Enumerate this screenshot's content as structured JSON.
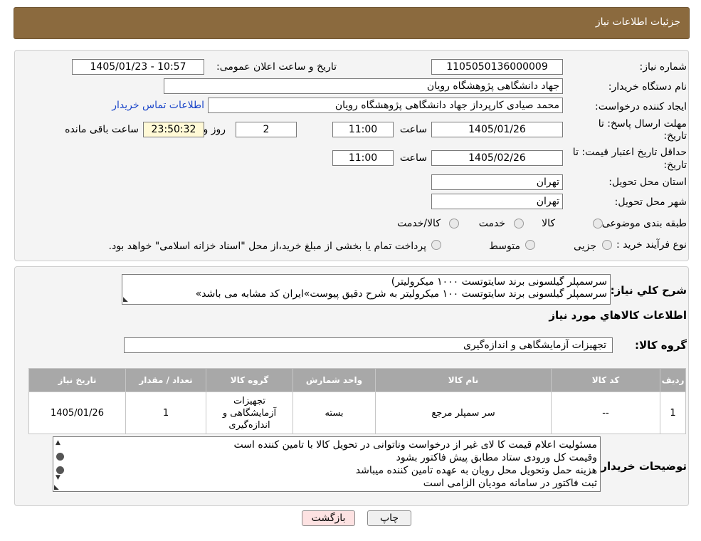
{
  "header": {
    "title": "جزئیات اطلاعات نیاز"
  },
  "form": {
    "need_number_label": "شماره نیاز:",
    "need_number": "1105050136000009",
    "announce_label": "تاریخ و ساعت اعلان عمومی:",
    "announce_value": "1405/01/23 - 10:57",
    "buyer_org_label": "نام دستگاه خریدار:",
    "buyer_org": "جهاد دانشگاهی پژوهشگاه رویان",
    "creator_label": "ایجاد کننده درخواست:",
    "creator": "محمد صیادی کارپرداز جهاد دانشگاهی پژوهشگاه رویان",
    "contact_link": "اطلاعات تماس خریدار",
    "deadline_label_1": "مهلت ارسال پاسخ: تا",
    "deadline_label_2": "تاریخ:",
    "deadline_date": "1405/01/26",
    "time_label": "ساعت",
    "deadline_time": "11:00",
    "days_value": "2",
    "days_label": "روز و",
    "remaining_time": "23:50:32",
    "remaining_label": "ساعت باقی مانده",
    "validity_label_1": "حداقل تاریخ اعتبار قیمت: تا",
    "validity_label_2": "تاریخ:",
    "validity_date": "1405/02/26",
    "validity_time": "11:00",
    "province_label": "استان محل تحویل:",
    "province": "تهران",
    "city_label": "شهر محل تحویل:",
    "city": "تهران",
    "category_label": "طبقه بندی موضوعی:",
    "category_options": [
      "کالا",
      "خدمت",
      "کالا/خدمت"
    ],
    "process_label": "نوع فرآیند خرید :",
    "process_options": [
      "جزیی",
      "متوسط"
    ],
    "process_note": "پرداخت تمام یا بخشی از مبلغ خرید،از محل \"اسناد خزانه اسلامی\" خواهد بود."
  },
  "desc": {
    "label": "شرح کلي نياز:",
    "lines": [
      "سرسمپلر گیلسونی برند سایتوتست ۱۰۰۰ میکرولیتر)",
      "سرسمپلر گیلسونی برند سایتوتست ۱۰۰ میکرولیتر به شرح دقیق پیوست»ایران کد مشابه می باشد»"
    ]
  },
  "goods": {
    "section_title": "اطلاعات کالاهاي مورد نياز",
    "group_label": "گروه کالا:",
    "group_value": "تجهیزات آزمایشگاهی و اندازه‌گیری",
    "columns": [
      "ردیف",
      "کد کالا",
      "نام کالا",
      "واحد شمارش",
      "گروه کالا",
      "تعداد / مقدار",
      "تاریخ نیاز"
    ],
    "rows": [
      [
        "1",
        "--",
        "سر سمپلر مرجع",
        "بسته",
        "تجهیزات آزمایشگاهی و اندازه‌گیری",
        "1",
        "1405/01/26"
      ]
    ]
  },
  "notes": {
    "label": "توضیحات خریدار:",
    "lines": [
      "مسئولیت اعلام قیمت کا لای  غیر از درخواست وناتوانی در تحویل کالا با تامین کننده است",
      "وقیمت کل ورودی ستاد مطابق پیش فاکتور بشود",
      "هزینه حمل وتحویل محل رویان به عهده تامین کننده میباشد",
      "ثبت فاکتور در سامانه مودیان الزامی است"
    ]
  },
  "buttons": {
    "print": "چاپ",
    "back": "بازگشت"
  }
}
